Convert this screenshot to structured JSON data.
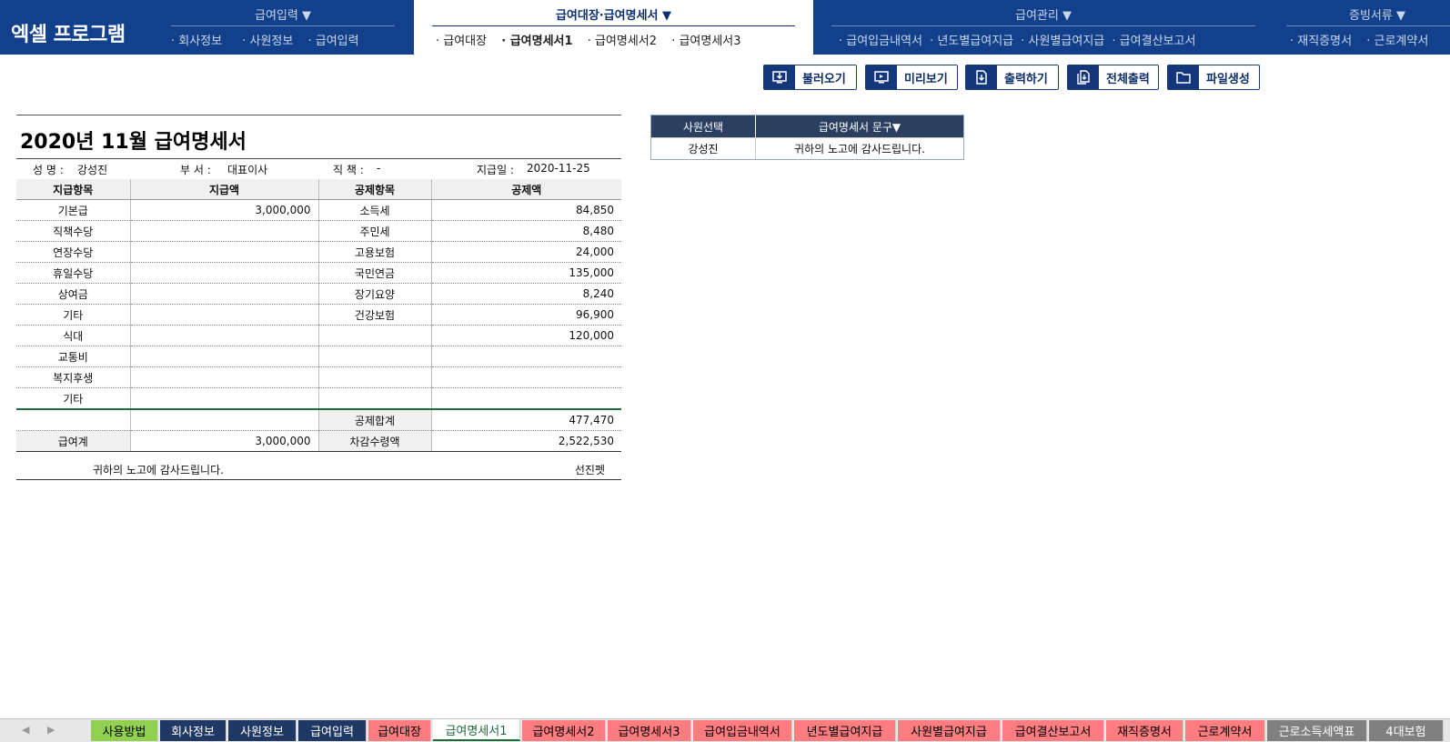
{
  "app": {
    "logo": "엑셀 프로그램"
  },
  "nav": {
    "groups": [
      {
        "label": "급여입력 ▼",
        "items": [
          "· 회사정보",
          "· 사원정보",
          "· 급여입력"
        ]
      },
      {
        "label": "급여대장·급여명세서 ▼",
        "items": [
          "· 급여대장",
          "· 급여명세서1",
          "· 급여명세서2",
          "· 급여명세서3"
        ]
      },
      {
        "label": "급여관리 ▼",
        "items": [
          "· 급여입금내역서",
          "· 년도별급여지급",
          "· 사원별급여지급",
          "· 급여결산보고서"
        ]
      },
      {
        "label": "증빙서류 ▼",
        "items": [
          "· 재직증명서",
          "· 근로계약서"
        ]
      }
    ]
  },
  "toolbar": {
    "load": "불러오기",
    "preview": "미리보기",
    "print": "출력하기",
    "print_all": "전체출력",
    "make_file": "파일생성"
  },
  "statement": {
    "title": "2020년 11월 급여명세서",
    "name_label": "성 명 :",
    "name": "강성진",
    "dept_label": "부 서 :",
    "dept": "대표이사",
    "position_label": "직 책 :",
    "position": "-",
    "paydate_label": "지급일 :",
    "paydate": "2020-11-25",
    "headers": {
      "pay_item": "지급항목",
      "pay_amount": "지급액",
      "deduct_item": "공제항목",
      "deduct_amount": "공제액"
    },
    "rows": [
      {
        "pay_item": "기본급",
        "pay_amount": "3,000,000",
        "deduct_item": "소득세",
        "deduct_amount": "84,850"
      },
      {
        "pay_item": "직책수당",
        "pay_amount": "",
        "deduct_item": "주민세",
        "deduct_amount": "8,480"
      },
      {
        "pay_item": "연장수당",
        "pay_amount": "",
        "deduct_item": "고용보험",
        "deduct_amount": "24,000"
      },
      {
        "pay_item": "휴일수당",
        "pay_amount": "",
        "deduct_item": "국민연금",
        "deduct_amount": "135,000"
      },
      {
        "pay_item": "상여금",
        "pay_amount": "",
        "deduct_item": "장기요양",
        "deduct_amount": "8,240"
      },
      {
        "pay_item": "기타",
        "pay_amount": "",
        "deduct_item": "건강보험",
        "deduct_amount": "96,900"
      },
      {
        "pay_item": "식대",
        "pay_amount": "",
        "deduct_item": "",
        "deduct_amount": "120,000"
      },
      {
        "pay_item": "교통비",
        "pay_amount": "",
        "deduct_item": "",
        "deduct_amount": ""
      },
      {
        "pay_item": "복지후생",
        "pay_amount": "",
        "deduct_item": "",
        "deduct_amount": ""
      },
      {
        "pay_item": "기타",
        "pay_amount": "",
        "deduct_item": "",
        "deduct_amount": ""
      }
    ],
    "deduct_total_label": "공제합계",
    "deduct_total": "477,470",
    "pay_total_label": "급여계",
    "pay_total": "3,000,000",
    "net_label": "차감수령액",
    "net": "2,522,530",
    "message": "귀하의 노고에 감사드립니다.",
    "company": "선진펫"
  },
  "side_panel": {
    "employee_header": "사원선택",
    "phrase_header": "급여명세서 문구▼",
    "employee": "강성진",
    "phrase": "귀하의 노고에 감사드립니다."
  },
  "sheet_tabs": [
    {
      "label": "사용방법",
      "bg": "#92d050",
      "fg": "#000000"
    },
    {
      "label": "회사정보",
      "bg": "#1f3864",
      "fg": "#ffffff"
    },
    {
      "label": "사원정보",
      "bg": "#1f3864",
      "fg": "#ffffff"
    },
    {
      "label": "급여입력",
      "bg": "#1f3864",
      "fg": "#ffffff"
    },
    {
      "label": "급여대장",
      "bg": "#ff7c80",
      "fg": "#000000"
    },
    {
      "label": "급여명세서1",
      "bg": "#ffffff",
      "fg": "#1d6b3a",
      "active": true
    },
    {
      "label": "급여명세서2",
      "bg": "#ff7c80",
      "fg": "#000000"
    },
    {
      "label": "급여명세서3",
      "bg": "#ff7c80",
      "fg": "#000000"
    },
    {
      "label": "급여입금내역서",
      "bg": "#ff7c80",
      "fg": "#000000"
    },
    {
      "label": "년도별급여지급",
      "bg": "#ff7c80",
      "fg": "#000000"
    },
    {
      "label": "사원별급여지급",
      "bg": "#ff7c80",
      "fg": "#000000"
    },
    {
      "label": "급여결산보고서",
      "bg": "#ff7c80",
      "fg": "#000000"
    },
    {
      "label": "재직증명서",
      "bg": "#ff7c80",
      "fg": "#000000"
    },
    {
      "label": "근로계약서",
      "bg": "#ff7c80",
      "fg": "#000000"
    },
    {
      "label": "근로소득세액표",
      "bg": "#808080",
      "fg": "#ffffff"
    },
    {
      "label": "4대보험",
      "bg": "#808080",
      "fg": "#ffffff"
    }
  ],
  "colors": {
    "topbar": "#12408a",
    "panel_header": "#2b3f61",
    "accent_green": "#1d6b3a"
  }
}
